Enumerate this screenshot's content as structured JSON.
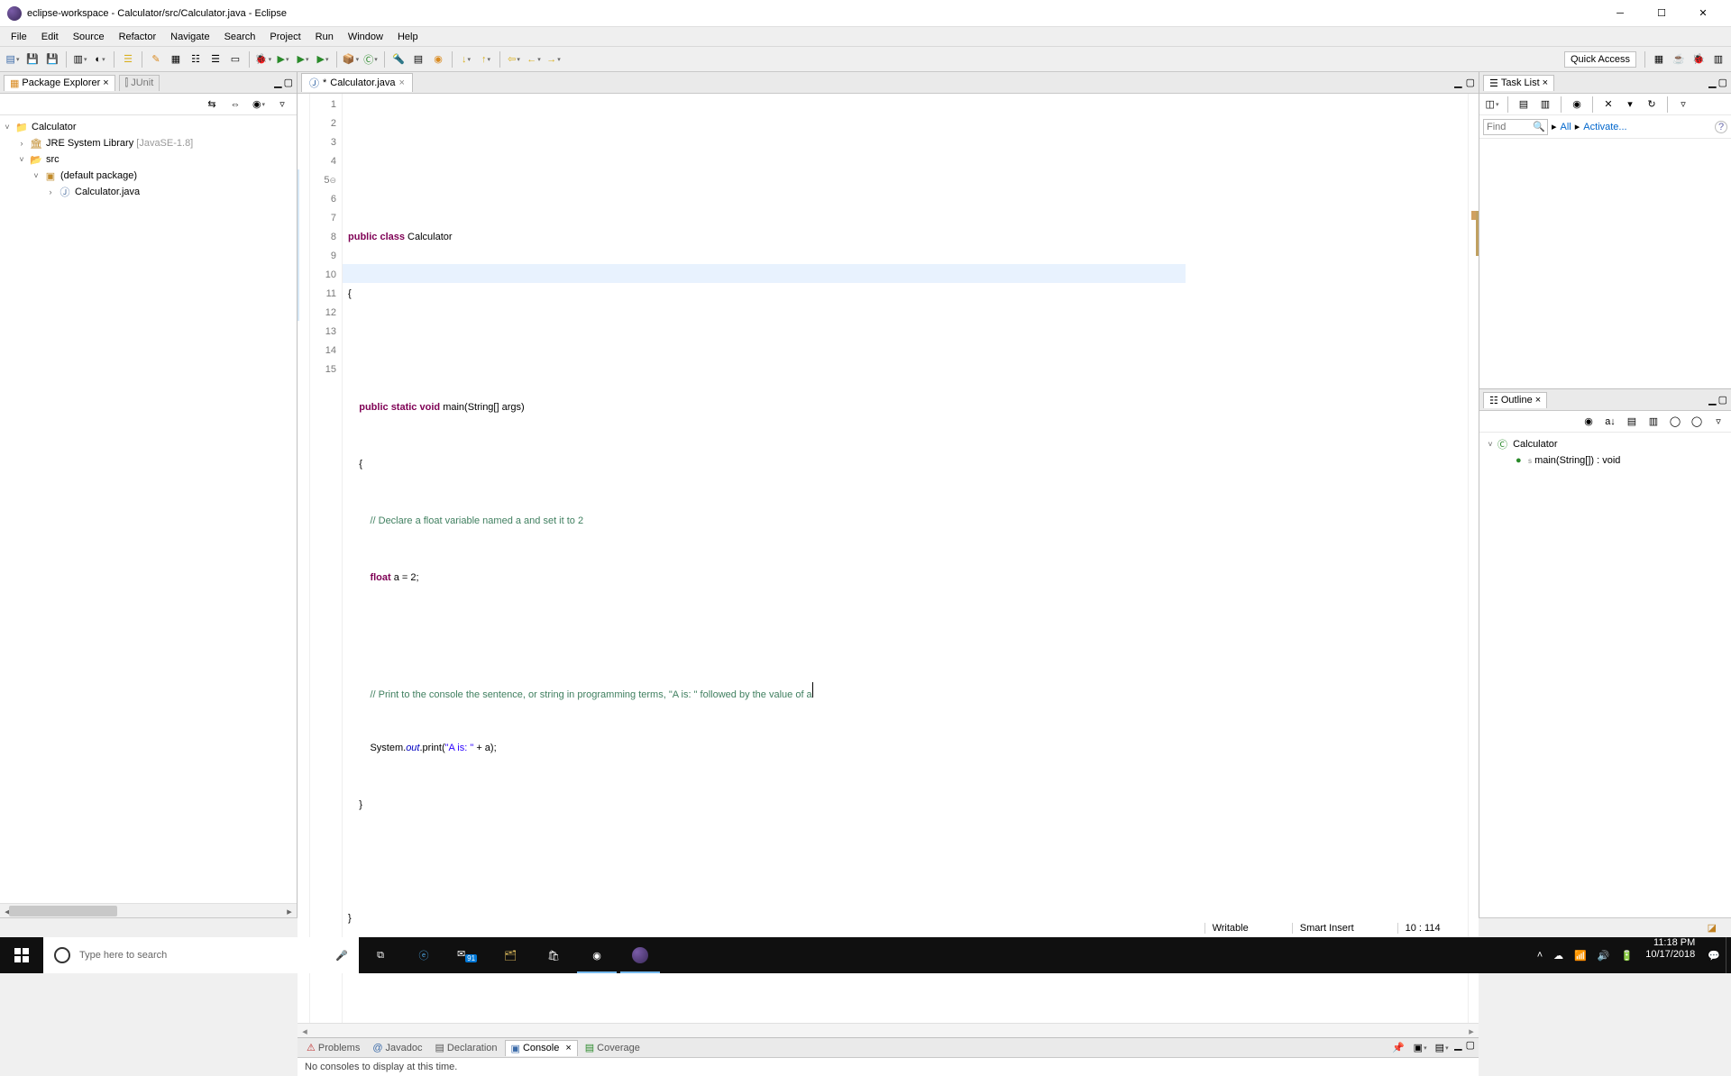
{
  "window": {
    "title": "eclipse-workspace - Calculator/src/Calculator.java - Eclipse"
  },
  "menu": [
    "File",
    "Edit",
    "Source",
    "Refactor",
    "Navigate",
    "Search",
    "Project",
    "Run",
    "Window",
    "Help"
  ],
  "quick_access": "Quick Access",
  "package_explorer": {
    "title": "Package Explorer",
    "junit": "JUnit",
    "project": "Calculator",
    "jre": "JRE System Library",
    "jre_ver": "[JavaSE-1.8]",
    "src": "src",
    "pkg": "(default package)",
    "file": "Calculator.java"
  },
  "editor": {
    "tab": "Calculator.java",
    "lines": [
      "1",
      "2",
      "3",
      "4",
      "5",
      "6",
      "7",
      "8",
      "9",
      "10",
      "11",
      "12",
      "13",
      "14",
      "15"
    ],
    "code": {
      "l2_a": "public",
      "l2_b": "class",
      "l2_c": "Calculator",
      "l3": "{",
      "l5_a": "public",
      "l5_b": "static",
      "l5_c": "void",
      "l5_d": "main(String[] args)",
      "l6": "{",
      "l7": "// Declare a float variable named a and set it to 2",
      "l8_a": "float",
      "l8_b": " a = 2;",
      "l10": "// Print to the console the sentence, or string in programming terms, \"A is: \" followed by the value of a",
      "l11_a": "System.",
      "l11_b": "out",
      "l11_c": ".print(",
      "l11_d": "\"A is: \"",
      "l11_e": " + a);",
      "l12": "}",
      "l14": "}"
    }
  },
  "tasklist": {
    "title": "Task List",
    "find": "Find",
    "all": "All",
    "activate": "Activate..."
  },
  "outline": {
    "title": "Outline",
    "class": "Calculator",
    "method": "main(String[]) : void"
  },
  "bottom": {
    "problems": "Problems",
    "javadoc": "Javadoc",
    "declaration": "Declaration",
    "console": "Console",
    "coverage": "Coverage",
    "msg": "No consoles to display at this time."
  },
  "status": {
    "writable": "Writable",
    "insert": "Smart Insert",
    "pos": "10 : 114"
  },
  "taskbar": {
    "search": "Type here to search",
    "time": "11:18 PM",
    "date": "10/17/2018"
  }
}
